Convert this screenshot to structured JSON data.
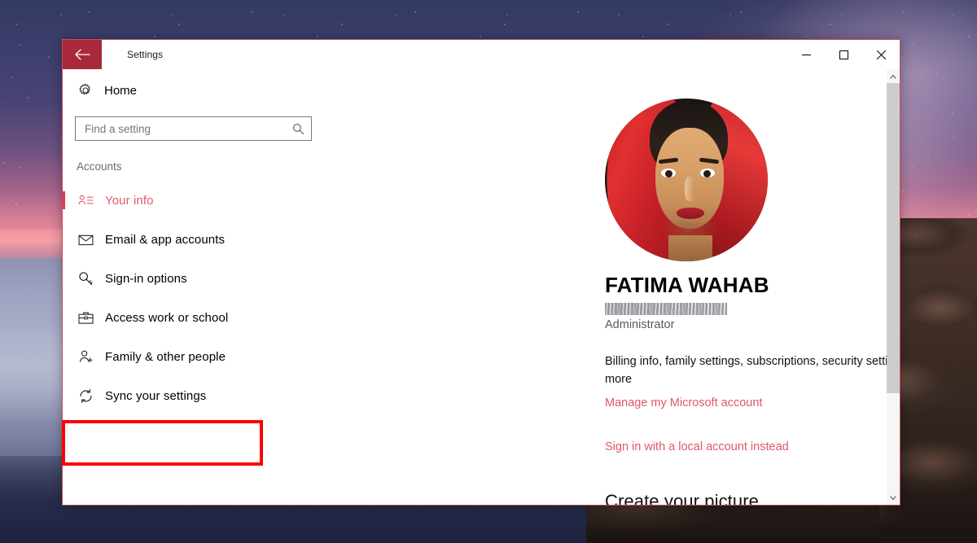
{
  "window": {
    "title": "Settings",
    "back_icon": "back-arrow-icon",
    "controls": {
      "minimize": "minimize-icon",
      "maximize": "maximize-icon",
      "close": "close-icon"
    }
  },
  "sidebar": {
    "home": {
      "label": "Home",
      "icon": "gear-icon"
    },
    "search": {
      "value": "",
      "placeholder": "Find a setting",
      "icon": "search-icon"
    },
    "section_title": "Accounts",
    "items": [
      {
        "label": "Your info",
        "icon": "user-info-icon",
        "active": true
      },
      {
        "label": "Email & app accounts",
        "icon": "envelope-icon",
        "active": false
      },
      {
        "label": "Sign-in options",
        "icon": "key-icon",
        "active": false
      },
      {
        "label": "Access work or school",
        "icon": "briefcase-icon",
        "active": false
      },
      {
        "label": "Family & other people",
        "icon": "person-add-icon",
        "active": false
      },
      {
        "label": "Sync your settings",
        "icon": "sync-icon",
        "active": false
      }
    ]
  },
  "main": {
    "avatar_alt": "profile-photo",
    "user_name": "FATIMA WAHAB",
    "user_email": "",
    "user_role": "Administrator",
    "description": "Billing info, family settings, subscriptions, security settings, and more",
    "manage_account_link": "Manage my Microsoft account",
    "local_account_link": "Sign in with a local account instead",
    "create_picture_heading": "Create your picture"
  },
  "scrollbar": {
    "up_icon": "chevron-up-icon",
    "down_icon": "chevron-down-icon"
  },
  "annotation": {
    "highlight_target": "Sync your settings",
    "highlight_color": "#ff0000"
  },
  "colors": {
    "accent": "#e0566c",
    "titlebar_back": "#a8293a",
    "active_indicator": "#e03a52"
  }
}
